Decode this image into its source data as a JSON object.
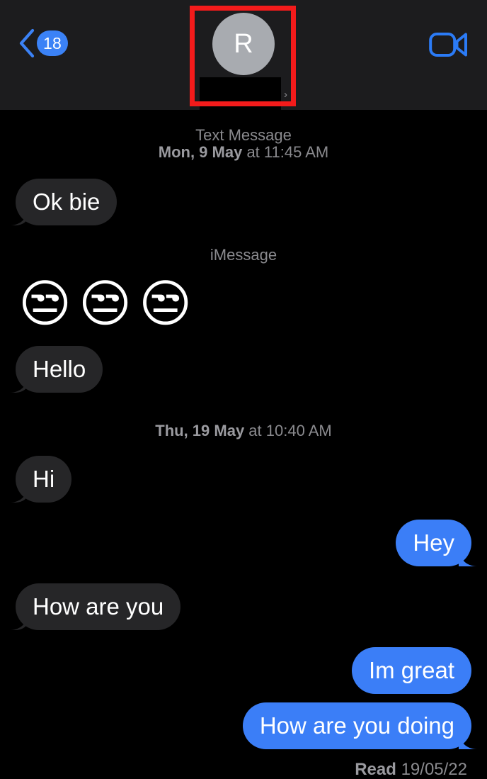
{
  "app": {
    "name": "Messages",
    "theme": "dark",
    "colors": {
      "background": "#000000",
      "nav_background": "#1c1c1e",
      "accent_blue": "#3b82f6",
      "sent_bubble": "#3b7ef7",
      "received_bubble": "#262628",
      "secondary_text": "#8a8a8e",
      "annotation_red": "#f31b1b",
      "avatar_gray": "#a8abb0"
    }
  },
  "nav": {
    "back_label": "back-chevron",
    "unread_count": "18",
    "facetime_label": "video-call",
    "contact": {
      "avatar_initial": "R",
      "name": "",
      "name_redacted": true,
      "disclosure_chevron": "›"
    },
    "annotation": {
      "shape": "rectangle",
      "color": "#f31b1b",
      "target": "contact-header"
    }
  },
  "conversation": {
    "items": [
      {
        "kind": "timestamp",
        "strong": "Mon, 9 May",
        "rest": " at 11:45 AM",
        "service": "Text Message"
      },
      {
        "kind": "message",
        "direction": "in",
        "text": "Ok bie",
        "tail": true
      },
      {
        "kind": "service",
        "text": "iMessage"
      },
      {
        "kind": "emoji",
        "text": "😒😒😒",
        "emoji_name": "unamused-face",
        "count": 3
      },
      {
        "kind": "message",
        "direction": "in",
        "text": "Hello",
        "tail": true
      },
      {
        "kind": "timestamp",
        "strong": "Thu, 19 May",
        "rest": " at 10:40 AM",
        "service": ""
      },
      {
        "kind": "message",
        "direction": "in",
        "text": "Hi",
        "tail": true
      },
      {
        "kind": "message",
        "direction": "out",
        "text": "Hey",
        "tail": true
      },
      {
        "kind": "message",
        "direction": "in",
        "text": "How are you",
        "tail": true
      },
      {
        "kind": "message",
        "direction": "out",
        "text": "Im great",
        "tail": false
      },
      {
        "kind": "message",
        "direction": "out",
        "text": "How are you doing",
        "tail": true
      },
      {
        "kind": "receipt",
        "label": "Read",
        "value": "19/05/22"
      }
    ]
  }
}
